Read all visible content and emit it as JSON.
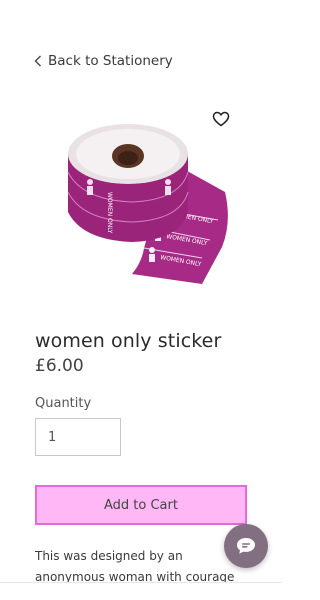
{
  "nav": {
    "back_label": "Back to Stationery"
  },
  "product": {
    "name": "women only sticker",
    "price": "£6.00",
    "image_alt": "roll of pink women only stickers",
    "sticker_label": "WOMEN ONLY"
  },
  "purchase": {
    "quantity_label": "Quantity",
    "quantity_value": "1",
    "add_to_cart_label": "Add to Cart"
  },
  "description": {
    "lines": [
      "This was designed by an",
      "anonymous woman with courage"
    ]
  },
  "colors": {
    "button_fill": "#ffb7f6",
    "button_border": "#e56ad7",
    "sticker_magenta": "#a72a86",
    "chat_bubble": "#826f81"
  },
  "icons": {
    "back": "chevron-left-icon",
    "wishlist": "heart-icon",
    "chat": "chat-bubble-icon"
  }
}
